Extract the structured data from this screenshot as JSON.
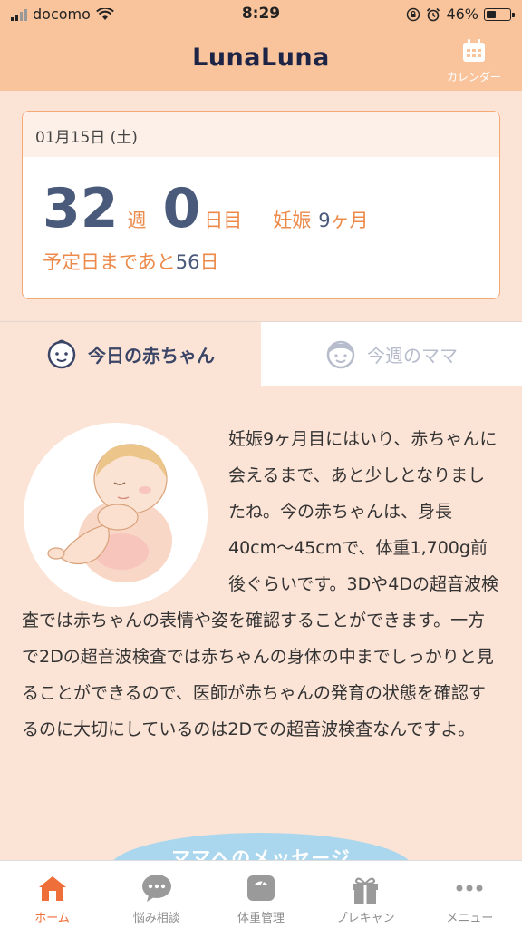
{
  "status_bar": {
    "carrier": "docomo",
    "time": "8:29",
    "battery": "46%",
    "battery_level": 0.46
  },
  "header": {
    "logo": "LunaLuna",
    "calendar_label": "カレンダー"
  },
  "date_card": {
    "date": "01月15日 (土)",
    "weeks": "32",
    "weeks_unit": "週",
    "days": "0",
    "days_unit": "日目",
    "pregnancy_label": "妊娠",
    "pregnancy_month": "9",
    "month_unit": "ヶ月",
    "remaining_prefix": "予定日まであと",
    "remaining_days": "56",
    "remaining_suffix": "日"
  },
  "tabs": [
    {
      "label": "今日の赤ちゃん",
      "icon": "baby-face-icon",
      "active": true
    },
    {
      "label": "今週のママ",
      "icon": "mama-face-icon",
      "active": false
    }
  ],
  "content": {
    "text": "妊娠9ヶ月目にはいり、赤ちゃんに会えるまで、あと少しとなりましたね。今の赤ちゃんは、身長40cm〜45cmで、体重1,700g前後ぐらいです。3Dや4Dの超音波検査では赤ちゃんの表情や姿を確認することができます。一方で2Dの超音波検査では赤ちゃんの身体の中までしっかりと見ることができるので、医師が赤ちゃんの発育の状態を確認するのに大切にしているのは2Dでの超音波検査なんですよ。",
    "message_banner": "ママへのメッセージ"
  },
  "bottom_nav": [
    {
      "label": "ホーム",
      "icon": "home-icon",
      "active": true
    },
    {
      "label": "悩み相談",
      "icon": "chat-bubble-icon",
      "active": false
    },
    {
      "label": "体重管理",
      "icon": "scale-icon",
      "active": false
    },
    {
      "label": "プレキャン",
      "icon": "gift-icon",
      "active": false
    },
    {
      "label": "メニュー",
      "icon": "more-dots-icon",
      "active": false
    }
  ],
  "colors": {
    "header_bg": "#f9c49c",
    "accent_orange": "#ec8a4a",
    "number_navy": "#4a5a7a",
    "content_bg": "#fbe3d6",
    "nav_active": "#ef6f3a"
  }
}
